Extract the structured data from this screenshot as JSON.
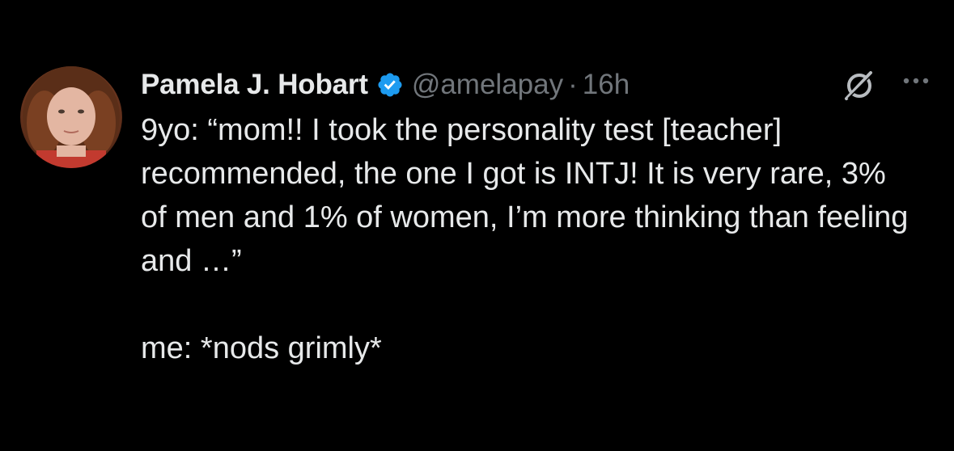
{
  "tweet": {
    "author_name": "Pamela J. Hobart",
    "handle": "@amelapay",
    "separator": "·",
    "timestamp": "16h",
    "verified_color": "#1d9bf0",
    "text": "9yo: “mom!! I took the personality test [teacher] recommended, the one I got is INTJ! It is very rare, 3% of men and 1% of women, I’m more thinking than feeling and …”\n\nme: *nods grimly*",
    "icons": [
      "avatar",
      "verified-badge-icon",
      "grok-icon",
      "more-options-icon"
    ]
  }
}
